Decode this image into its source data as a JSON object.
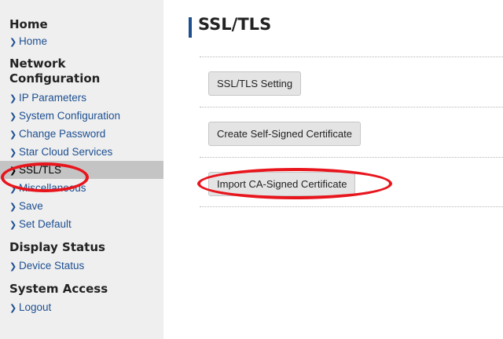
{
  "sidebar": {
    "sections": [
      {
        "title": "Home",
        "items": [
          "Home"
        ]
      },
      {
        "title": "Network Configuration",
        "items": [
          "IP Parameters",
          "System Configuration",
          "Change Password",
          "Star Cloud Services",
          "SSL/TLS",
          "Miscellaneous",
          "Save",
          "Set Default"
        ]
      },
      {
        "title": "Display Status",
        "items": [
          "Device Status"
        ]
      },
      {
        "title": "System Access",
        "items": [
          "Logout"
        ]
      }
    ],
    "active_item": "SSL/TLS"
  },
  "main": {
    "title": "SSL/TLS",
    "buttons": [
      "SSL/TLS Setting",
      "Create Self-Signed Certificate",
      "Import CA-Signed Certificate"
    ]
  },
  "colors": {
    "accent": "#1d4f91",
    "highlight_ring": "#e8151d",
    "active_bg": "#c4c4c4"
  }
}
